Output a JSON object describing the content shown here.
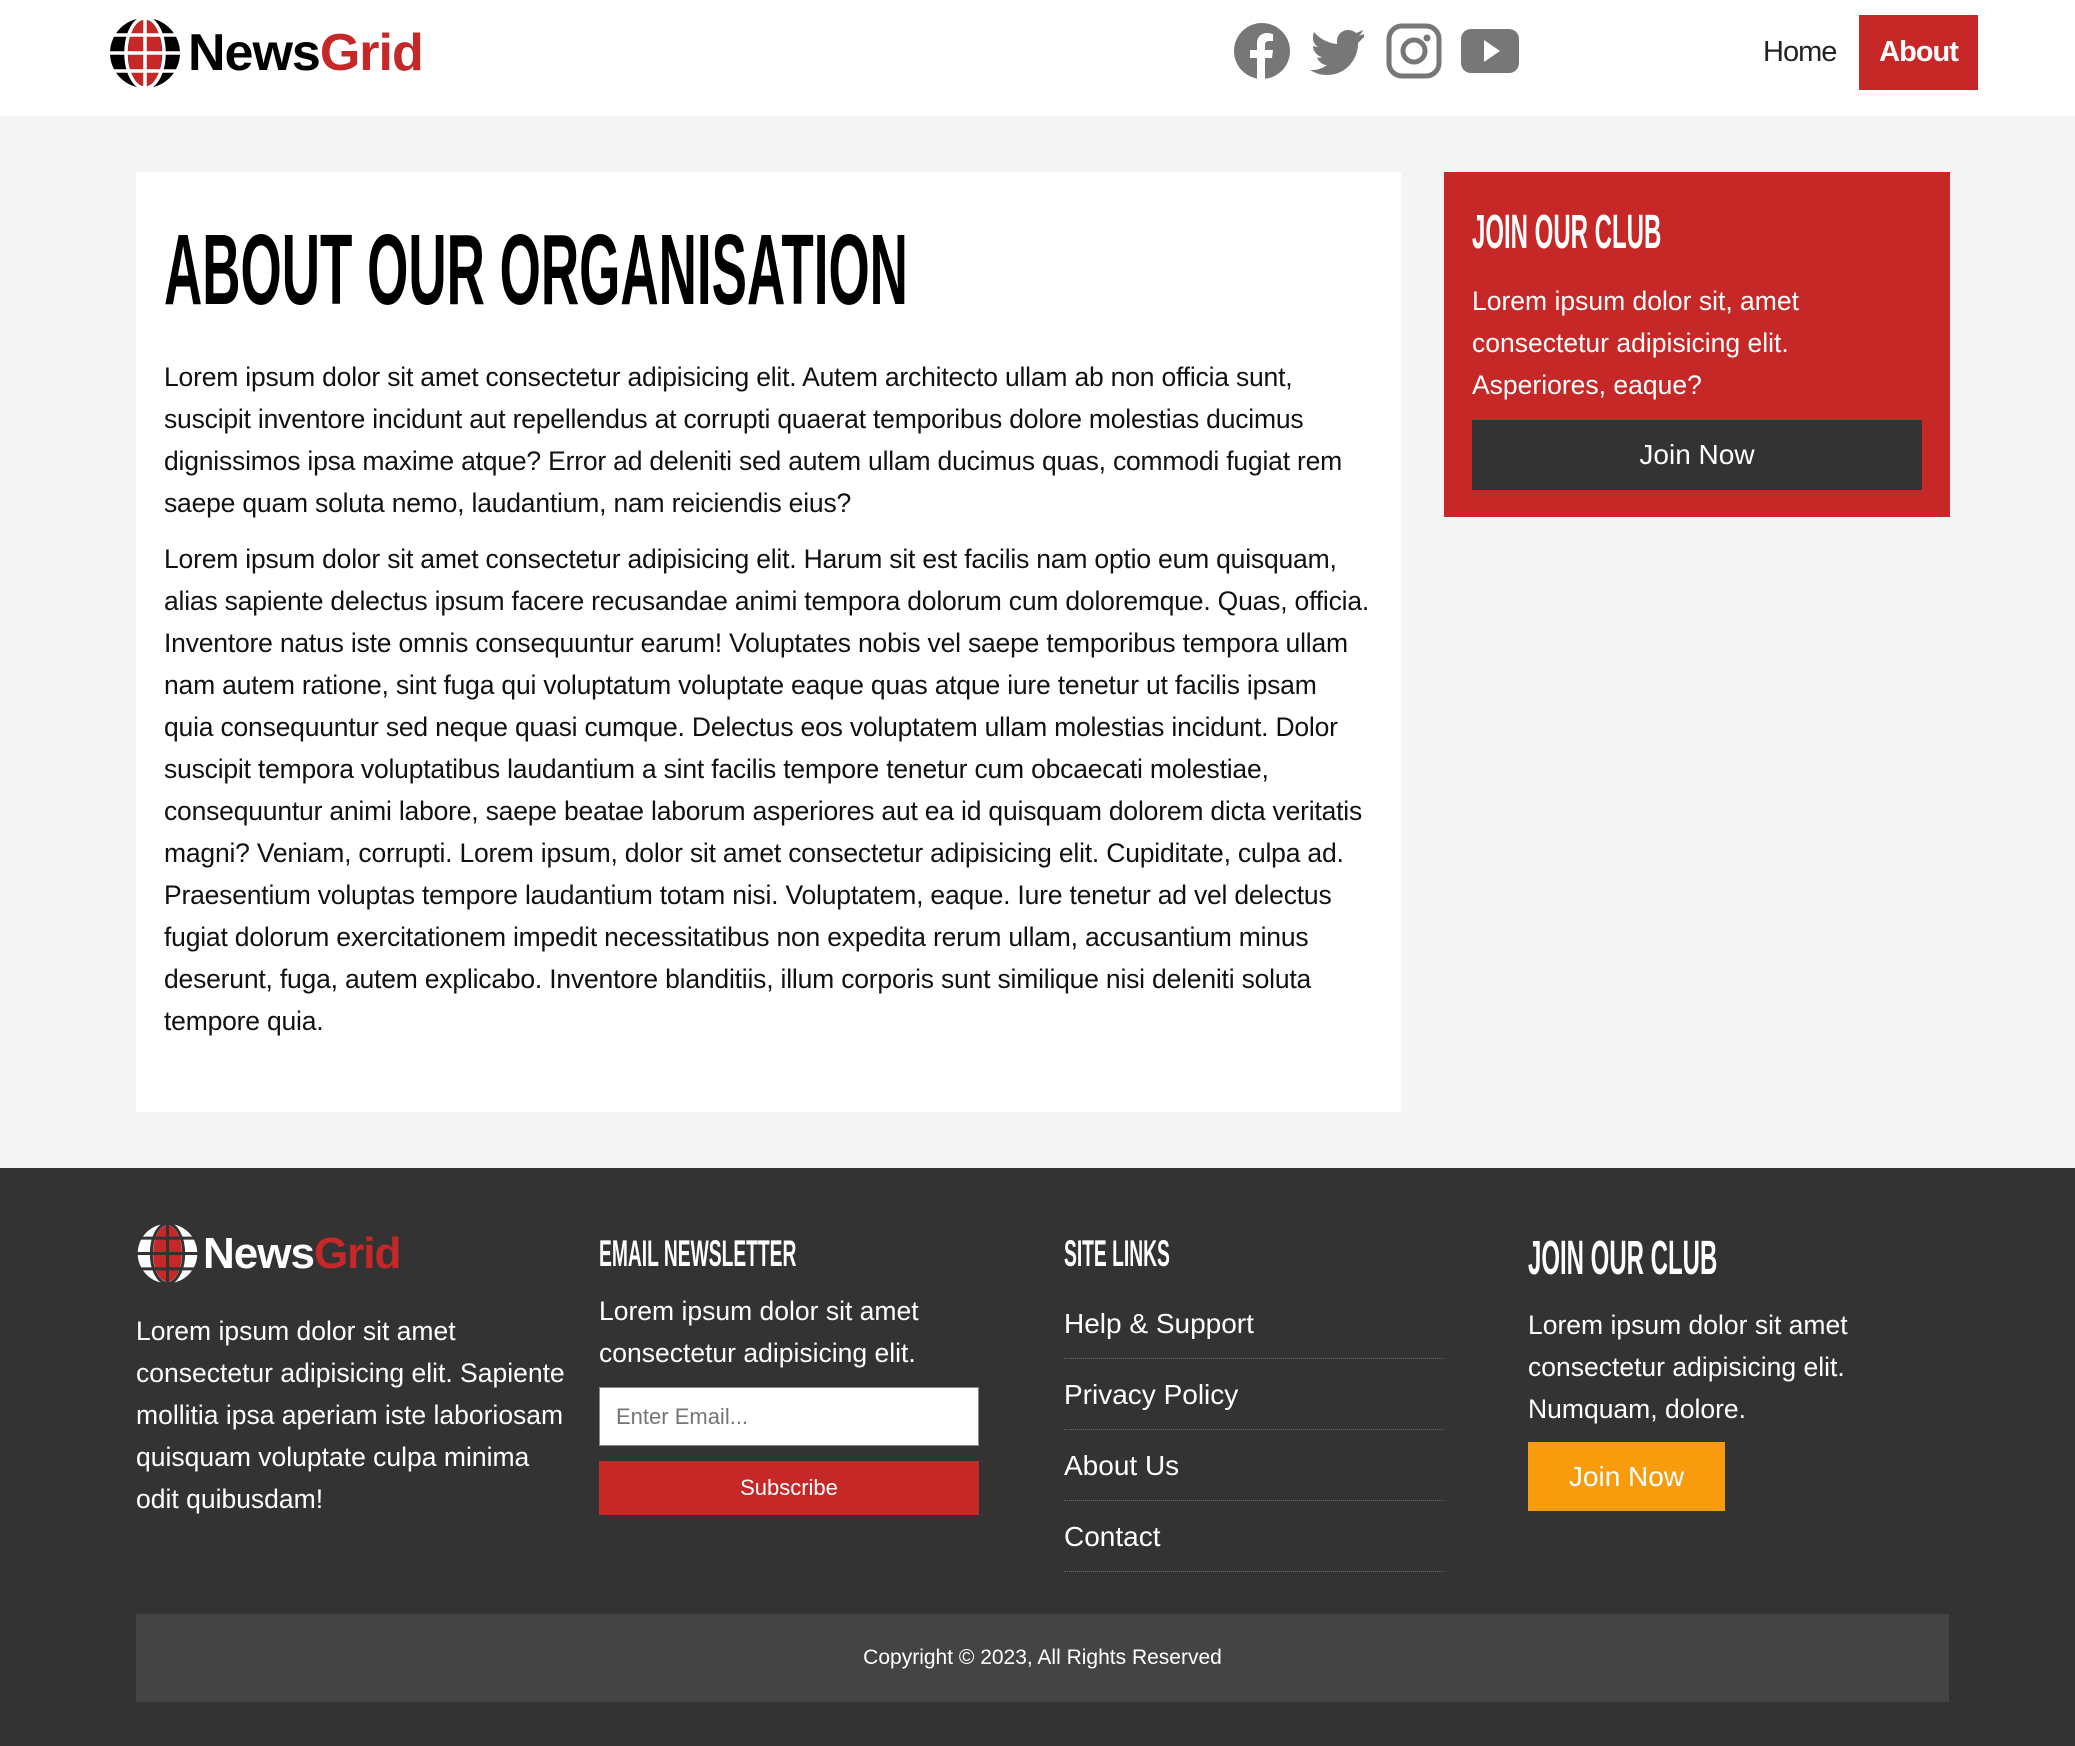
{
  "brand": {
    "name_part1": "News",
    "name_part2": "Grid",
    "accent": "#c62828"
  },
  "header": {
    "social": [
      "facebook-icon",
      "twitter-icon",
      "instagram-icon",
      "youtube-icon"
    ],
    "nav": [
      {
        "label": "Home",
        "active": false
      },
      {
        "label": "About",
        "active": true
      }
    ]
  },
  "main": {
    "title": "ABOUT OUR ORGANISATION",
    "paragraphs": [
      "Lorem ipsum dolor sit amet consectetur adipisicing elit. Autem architecto ullam ab non officia sunt, suscipit inventore incidunt aut repellendus at corrupti quaerat temporibus dolore molestias ducimus dignissimos ipsa maxime atque? Error ad deleniti sed autem ullam ducimus quas, commodi fugiat rem saepe quam soluta nemo, laudantium, nam reiciendis eius?",
      "Lorem ipsum dolor sit amet consectetur adipisicing elit. Harum sit est facilis nam optio eum quisquam, alias sapiente delectus ipsum facere recusandae animi tempora dolorum cum doloremque. Quas, officia. Inventore natus iste omnis consequuntur earum! Voluptates nobis vel saepe temporibus tempora ullam nam autem ratione, sint fuga qui voluptatum voluptate eaque quas atque iure tenetur ut facilis ipsam quia consequuntur sed neque quasi cumque. Delectus eos voluptatem ullam molestias incidunt. Dolor suscipit tempora voluptatibus laudantium a sint facilis tempore tenetur cum obcaecati molestiae, consequuntur animi labore, saepe beatae laborum asperiores aut ea id quisquam dolorem dicta veritatis magni? Veniam, corrupti. Lorem ipsum, dolor sit amet consectetur adipisicing elit. Cupiditate, culpa ad. Praesentium voluptas tempore laudantium totam nisi. Voluptatem, eaque. Iure tenetur ad vel delectus fugiat dolorum exercitationem impedit necessitatibus non expedita rerum ullam, accusantium minus deserunt, fuga, autem explicabo. Inventore blanditiis, illum corporis sunt similique nisi deleniti soluta tempore quia."
    ]
  },
  "sidebar": {
    "title": "JOIN OUR CLUB",
    "text": "Lorem ipsum dolor sit, amet consectetur adipisicing elit. Asperiores, eaque?",
    "button": "Join Now"
  },
  "footer": {
    "about_text": "Lorem ipsum dolor sit amet consectetur adipisicing elit. Sapiente mollitia ipsa aperiam iste laboriosam quisquam voluptate culpa minima odit quibusdam!",
    "newsletter": {
      "title": "EMAIL NEWSLETTER",
      "text": "Lorem ipsum dolor sit amet consectetur adipisicing elit.",
      "placeholder": "Enter Email...",
      "button": "Subscribe"
    },
    "links": {
      "title": "SITE LINKS",
      "items": [
        "Help & Support",
        "Privacy Policy",
        "About Us",
        "Contact"
      ]
    },
    "club": {
      "title": "JOIN OUR CLUB",
      "text": "Lorem ipsum dolor sit amet consectetur adipisicing elit. Numquam, dolore.",
      "button": "Join Now",
      "button_color": "#f89c0e"
    },
    "copyright": "Copyright © 2023, All Rights Reserved"
  }
}
